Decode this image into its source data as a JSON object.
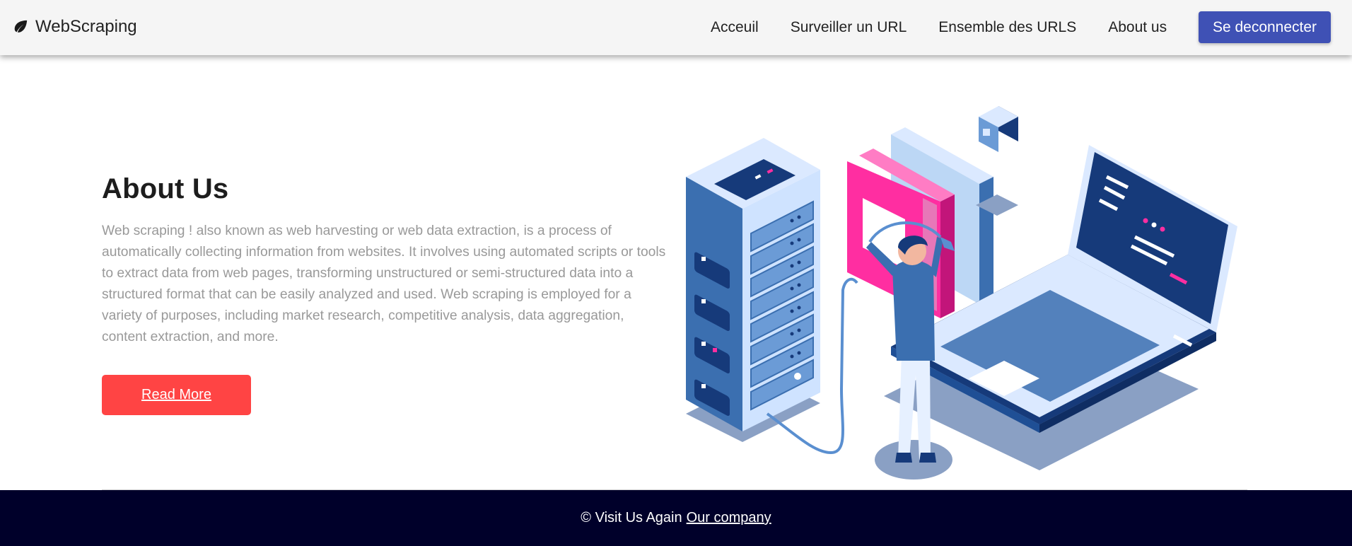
{
  "navbar": {
    "brand_icon": "leaf-icon",
    "brand": "WebScraping",
    "links": [
      "Acceuil",
      "Surveiller un URL",
      "Ensemble des URLS",
      "About us"
    ],
    "logout": "Se deconnecter"
  },
  "about": {
    "title": "About Us",
    "text": "Web scraping ! also known as web harvesting or web data extraction, is a process of automatically collecting information from websites. It involves using automated scripts or tools to extract data from web pages, transforming unstructured or semi-structured data into a structured format that can be easily analyzed and used. Web scraping is employed for a variety of purposes, including market research, competitive analysis, data aggregation, content extraction, and more.",
    "read_more": "Read More"
  },
  "illustration": {
    "icon": "server-laptop-illustration"
  },
  "footer": {
    "text": "© Visit Us Again",
    "link": "Our company"
  },
  "colors": {
    "primary": "#3f51b5",
    "accent": "#ff4444",
    "footer_bg": "#00002a",
    "navy": "#163a7a",
    "pink": "#ff2ea1"
  }
}
